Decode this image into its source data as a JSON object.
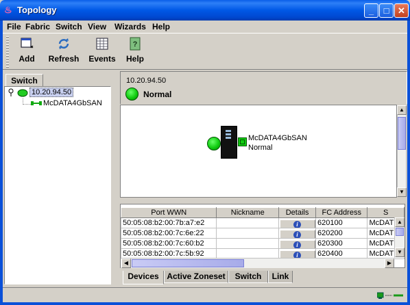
{
  "window": {
    "title": "Topology"
  },
  "menu": [
    "File",
    "Fabric",
    "Switch",
    "View",
    "Wizards",
    "Help"
  ],
  "toolbar": {
    "add": "Add",
    "refresh": "Refresh",
    "events": "Events",
    "help": "Help"
  },
  "left_panel": {
    "tab": "Switch",
    "tree": {
      "root": "10.20.94.50",
      "child": "McDATA4GbSAN"
    }
  },
  "right_panel": {
    "ip": "10.20.94.50",
    "status": "Normal",
    "status_color": "#22cc22",
    "topology_node": {
      "name": "McDATA4GbSAN",
      "status": "Normal"
    }
  },
  "table": {
    "columns": [
      "Port WWN",
      "Nickname",
      "Details",
      "FC Address",
      "S"
    ],
    "rows": [
      {
        "port_wwn": "50:05:08:b2:00:7b:a7:e2",
        "nickname": "",
        "fc_address": "620100",
        "s": "McDAT"
      },
      {
        "port_wwn": "50:05:08:b2:00:7c:6e:22",
        "nickname": "",
        "fc_address": "620200",
        "s": "McDAT"
      },
      {
        "port_wwn": "50:05:08:b2:00:7c:60:b2",
        "nickname": "",
        "fc_address": "620300",
        "s": "McDAT"
      },
      {
        "port_wwn": "50:05:08:b2:00:7c:5b:92",
        "nickname": "",
        "fc_address": "620400",
        "s": "McDAT"
      }
    ]
  },
  "bottom_tabs": [
    "Devices",
    "Active Zoneset",
    "Switch",
    "Link"
  ],
  "statusbar": {
    "icon": "network-icon"
  }
}
